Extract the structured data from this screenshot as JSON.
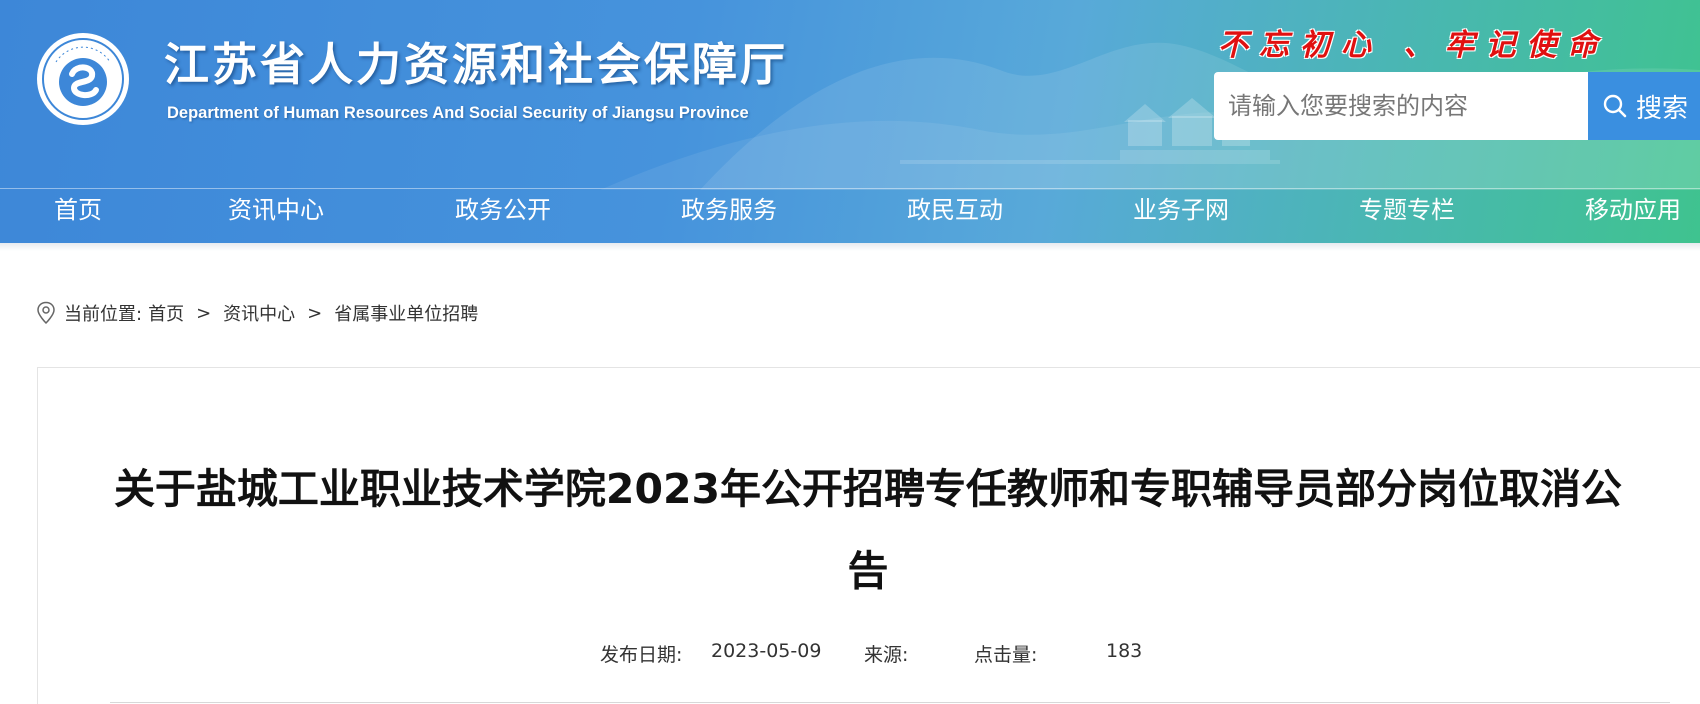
{
  "header": {
    "title": "江苏省人力资源和社会保障厅",
    "subtitle": "Department of Human Resources And Social Security of Jiangsu Province",
    "logo_text": "江苏省人力资源和社会保障厅",
    "slogan": "不忘初心 、牢记使命"
  },
  "search": {
    "placeholder": "请输入您要搜索的内容",
    "button_label": "搜索",
    "button_icon": "search-icon"
  },
  "nav": {
    "items": [
      {
        "label": "首页"
      },
      {
        "label": "资讯中心"
      },
      {
        "label": "政务公开"
      },
      {
        "label": "政务服务"
      },
      {
        "label": "政民互动"
      },
      {
        "label": "业务子网"
      },
      {
        "label": "专题专栏"
      },
      {
        "label": "移动应用"
      }
    ]
  },
  "breadcrumb": {
    "icon": "location-pin-icon",
    "prefix": "当前位置:",
    "items": [
      "首页",
      "资讯中心",
      "省属事业单位招聘"
    ],
    "separator": ">"
  },
  "article": {
    "title": "关于盐城工业职业技术学院2023年公开招聘专任教师和专职辅导员部分岗位取消公告",
    "meta": {
      "date_label": "发布日期:",
      "date_value": "2023-05-09",
      "source_label": "来源:",
      "source_value": "",
      "clicks_label": "点击量:",
      "clicks_value": "183"
    }
  },
  "colors": {
    "header_blue": "#3d87d8",
    "header_green": "#3fc38f",
    "search_button": "#3a8fe0",
    "slogan_red": "#e01010"
  }
}
